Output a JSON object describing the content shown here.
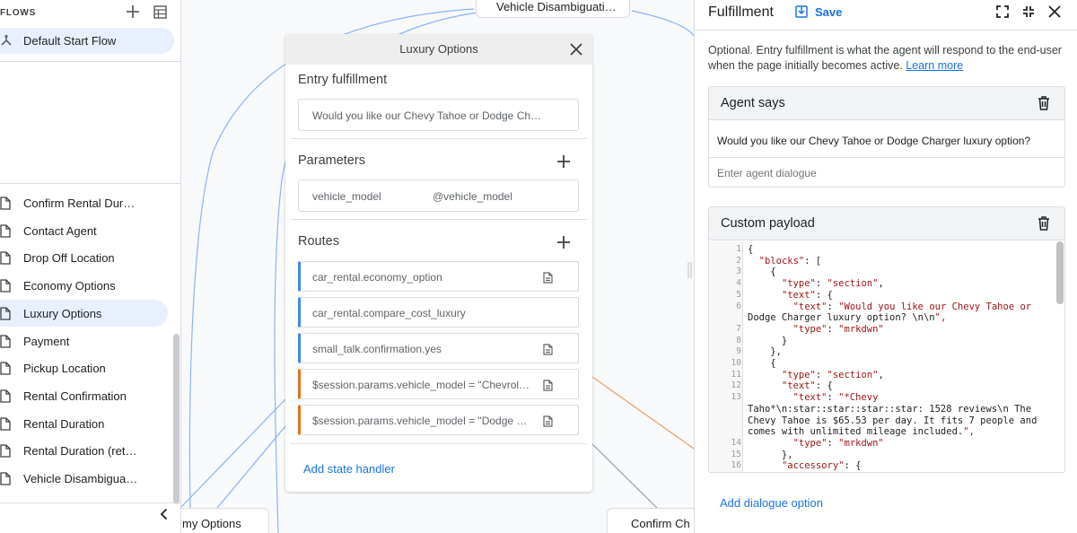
{
  "sidebar": {
    "flows_title": "FLOWS",
    "flow_item": "Default Start Flow",
    "pages": [
      "Confirm Rental Durati…",
      "Contact Agent",
      "Drop Off Location",
      "Economy Options",
      "Luxury Options",
      "Payment",
      "Pickup Location",
      "Rental Confirmation",
      "Rental Duration",
      "Rental Duration (retur…",
      "Vehicle Disambiguation"
    ],
    "active_page": "Luxury Options"
  },
  "canvas": {
    "node_top": "Vehicle Disambiguati…",
    "node_bottom_left": "my Options",
    "node_bottom_right": "Confirm Ch",
    "panel": {
      "title": "Luxury Options",
      "entry_title": "Entry fulfillment",
      "entry_value": "Would you like our Chevy Tahoe or Dodge Cha…",
      "params_title": "Parameters",
      "param_name": "vehicle_model",
      "param_value": "@vehicle_model",
      "routes_title": "Routes",
      "routes": [
        {
          "text": "car_rental.economy_option",
          "kind": "intent",
          "has_doc": true
        },
        {
          "text": "car_rental.compare_cost_luxury",
          "kind": "intent",
          "has_doc": false
        },
        {
          "text": "small_talk.confirmation.yes",
          "kind": "intent",
          "has_doc": true
        },
        {
          "text": "$session.params.vehicle_model = \"Chevrolet T…",
          "kind": "condition",
          "has_doc": true
        },
        {
          "text": "$session.params.vehicle_model = \"Dodge Ch…",
          "kind": "condition",
          "has_doc": true
        }
      ],
      "add_state_handler": "Add state handler"
    }
  },
  "fulfillment": {
    "title": "Fulfillment",
    "save_label": "Save",
    "description": "Optional. Entry fulfillment is what the agent will respond to the end-user when the page initially becomes active.",
    "learn_more": "Learn more",
    "agent_says": {
      "title": "Agent says",
      "text": "Would you like our Chevy Tahoe or Dodge Charger luxury option?",
      "placeholder": "Enter agent dialogue"
    },
    "custom_payload": {
      "title": "Custom payload",
      "lines": [
        {
          "n": "1",
          "t": "{"
        },
        {
          "n": "2",
          "t": "  \"blocks\": ["
        },
        {
          "n": "3",
          "t": "    {"
        },
        {
          "n": "4",
          "t": "      \"type\": \"section\","
        },
        {
          "n": "5",
          "t": "      \"text\": {"
        },
        {
          "n": "6",
          "t": "        \"text\": \"Would you like our Chevy Tahoe or"
        },
        {
          "n": "",
          "t": "Dodge Charger luxury option? \\n\\n\","
        },
        {
          "n": "7",
          "t": "        \"type\": \"mrkdwn\""
        },
        {
          "n": "8",
          "t": "      }"
        },
        {
          "n": "9",
          "t": "    },"
        },
        {
          "n": "10",
          "t": "    {"
        },
        {
          "n": "11",
          "t": "      \"type\": \"section\","
        },
        {
          "n": "12",
          "t": "      \"text\": {"
        },
        {
          "n": "13",
          "t": "        \"text\": \"*Chevy"
        },
        {
          "n": "",
          "t": "Taho*\\n:star::star::star::star: 1528 reviews\\n The"
        },
        {
          "n": "",
          "t": "Chevy Tahoe is $65.53 per day. It fits 7 people and"
        },
        {
          "n": "",
          "t": "comes with unlimited mileage included.\","
        },
        {
          "n": "14",
          "t": "        \"type\": \"mrkdwn\""
        },
        {
          "n": "15",
          "t": "      },"
        },
        {
          "n": "16",
          "t": "      \"accessory\": {"
        }
      ]
    },
    "add_dialogue": "Add dialogue option"
  },
  "colors": {
    "accent": "#1a73e8",
    "intent_route": "#4285f4",
    "condition_route": "#e8711a",
    "code_string": "#a31515",
    "active_bg": "#e8f0fe"
  }
}
